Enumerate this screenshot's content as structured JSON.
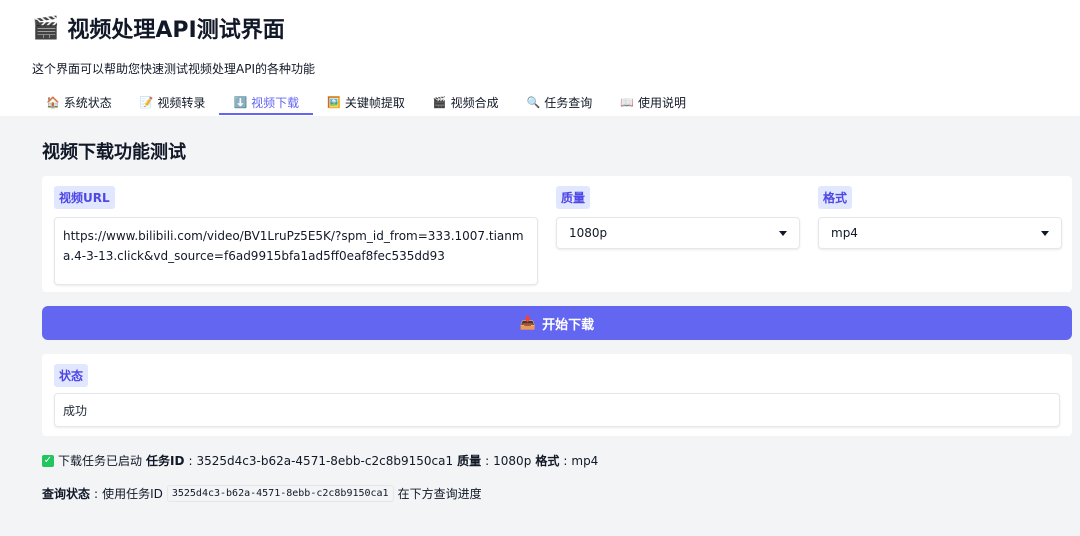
{
  "app": {
    "title_emoji": "🎬",
    "title": "视频处理API测试界面",
    "subtitle": "这个界面可以帮助您快速测试视频处理API的各种功能"
  },
  "tabs": [
    {
      "icon": "🏠",
      "label": "系统状态",
      "active": false
    },
    {
      "icon": "📝",
      "label": "视频转录",
      "active": false
    },
    {
      "icon": "⬇️",
      "label": "视频下载",
      "active": true
    },
    {
      "icon": "🖼️",
      "label": "关键帧提取",
      "active": false
    },
    {
      "icon": "🎬",
      "label": "视频合成",
      "active": false
    },
    {
      "icon": "🔍",
      "label": "任务查询",
      "active": false
    },
    {
      "icon": "📖",
      "label": "使用说明",
      "active": false
    }
  ],
  "section": {
    "title": "视频下载功能测试"
  },
  "form": {
    "url_label": "视频URL",
    "url_value": "https://www.bilibili.com/video/BV1LruPz5E5K/?spm_id_from=333.1007.tianma.4-3-13.click&vd_source=f6ad9915bfa1ad5ff0eaf8fec535dd93",
    "quality_label": "质量",
    "quality_value": "1080p",
    "format_label": "格式",
    "format_value": "mp4",
    "download_button": "开始下载",
    "download_icon": "📥"
  },
  "status": {
    "label": "状态",
    "value": "成功"
  },
  "result": {
    "prefix": "下载任务已启动",
    "task_id_label": "任务ID",
    "task_id": "3525d4c3-b62a-4571-8ebb-c2c8b9150ca1",
    "quality_label": "质量",
    "quality": "1080p",
    "format_label": "格式",
    "format": "mp4"
  },
  "query": {
    "label": "查询状态",
    "text_before": "使用任务ID",
    "code": "3525d4c3-b62a-4571-8ebb-c2c8b9150ca1",
    "text_after": "在下方查询进度"
  }
}
